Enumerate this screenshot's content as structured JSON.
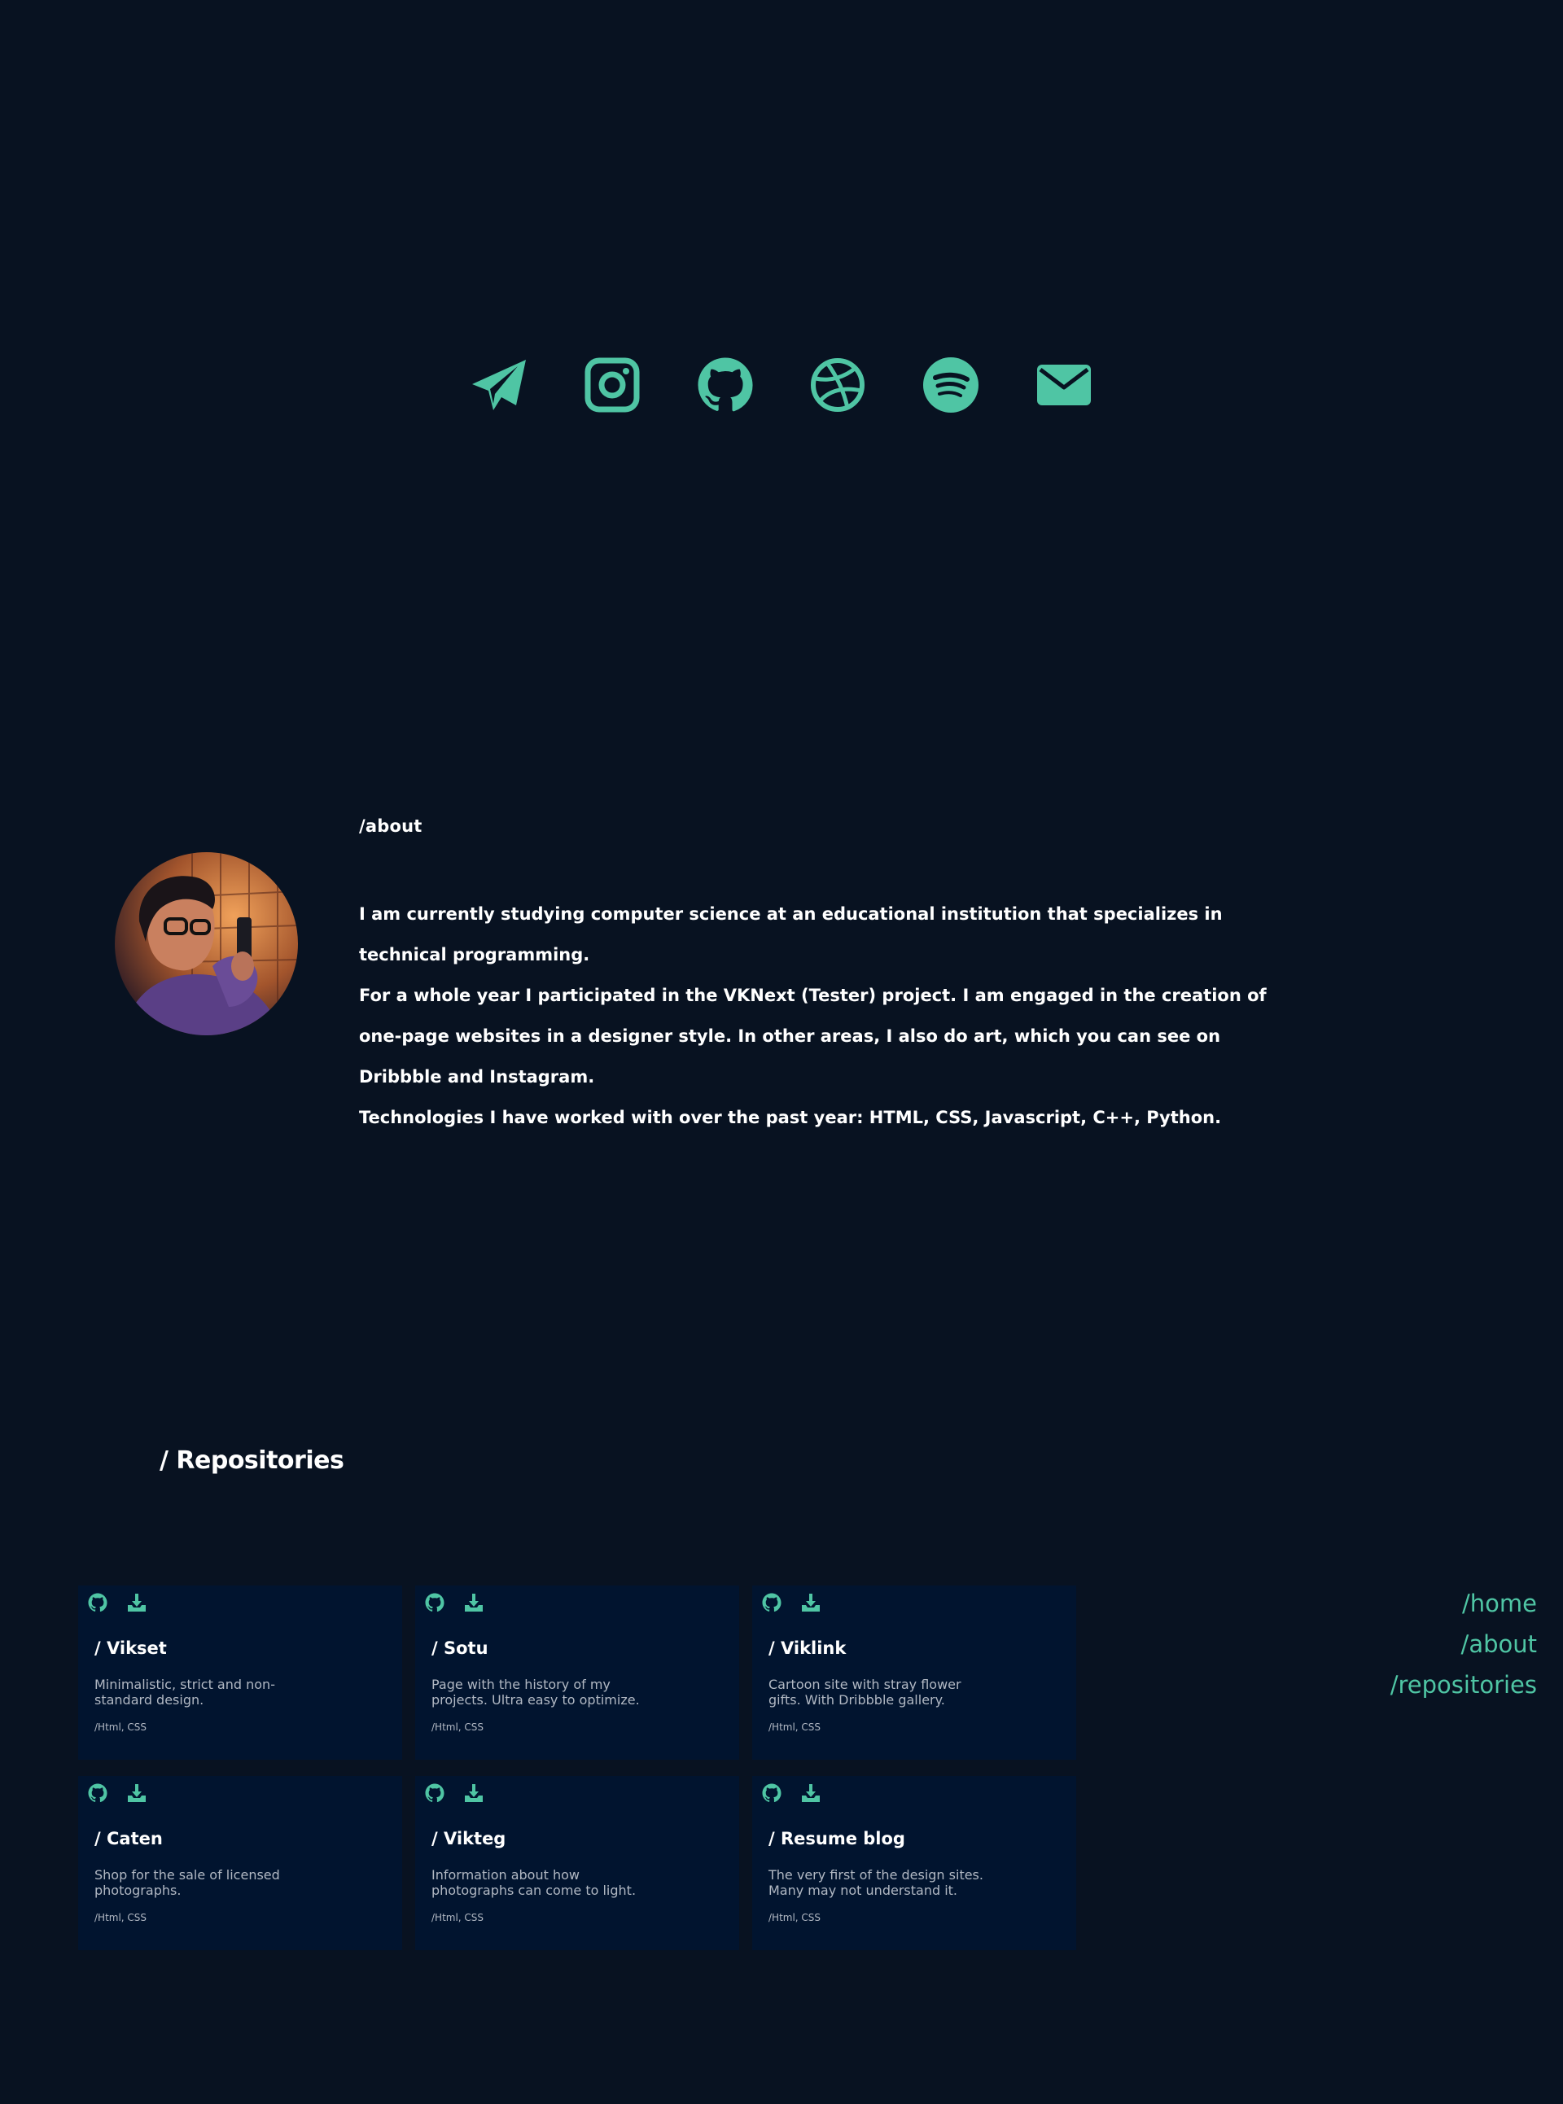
{
  "socials": [
    {
      "name": "telegram-icon"
    },
    {
      "name": "instagram-icon"
    },
    {
      "name": "github-icon"
    },
    {
      "name": "dribbble-icon"
    },
    {
      "name": "spotify-icon"
    },
    {
      "name": "mail-icon"
    }
  ],
  "about": {
    "title": "/about",
    "paragraphs": [
      "I am currently studying computer science at an educational institution that specializes in technical programming.",
      "For a whole year I participated in the VKNext (Tester) project. I am engaged in the creation of one-page websites in a designer style. In other areas, I also do art, which you can see on Dribbble and Instagram.",
      "Technologies I have worked with over the past year: HTML, CSS, Javascript, C++, Python."
    ]
  },
  "repositories": {
    "title": "/ Repositories",
    "items": [
      {
        "name": "/ Vikset",
        "description": "Minimalistic, strict and non-standard design.",
        "tech": "/Html, CSS"
      },
      {
        "name": "/ Sotu",
        "description": "Page with the history of my projects. Ultra easy to optimize.",
        "tech": "/Html, CSS"
      },
      {
        "name": "/ Viklink",
        "description": "Cartoon site with stray flower gifts. With Dribbble gallery.",
        "tech": "/Html, CSS"
      },
      {
        "name": "/ Caten",
        "description": "Shop for the sale of licensed photographs.",
        "tech": "/Html, CSS"
      },
      {
        "name": "/ Vikteg",
        "description": "Information about how photographs can come to light.",
        "tech": "/Html, CSS"
      },
      {
        "name": "/ Resume blog",
        "description": "The very first of the design sites. Many may not understand it.",
        "tech": "/Html, CSS"
      }
    ]
  },
  "nav": {
    "home": "/home",
    "about": "/about",
    "repositories": "/repositories"
  },
  "colors": {
    "background": "#081221",
    "accent": "#4fc5a4",
    "card": "#01142f",
    "muted_text": "#b1b8c3"
  }
}
